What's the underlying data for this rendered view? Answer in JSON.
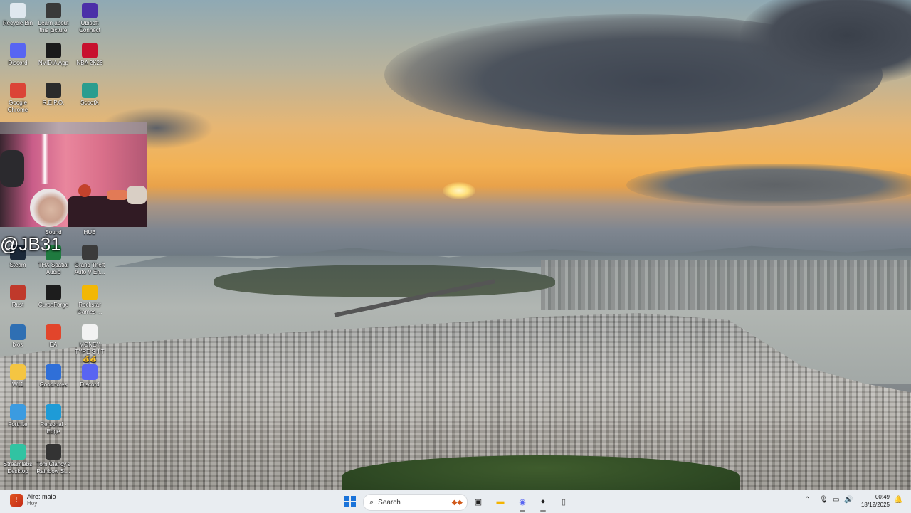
{
  "desktop": {
    "streamer_handle": "@JB31",
    "icons": [
      {
        "label": "Recycle Bin",
        "icon": "recycle-bin-icon",
        "color": "#dfe8ef"
      },
      {
        "label": "Learn about this picture",
        "icon": "camera-icon",
        "color": "#3a3a3a"
      },
      {
        "label": "Ubisoft Connect",
        "icon": "ubisoft-icon",
        "color": "#4b2fa8"
      },
      {
        "label": "Discord",
        "icon": "discord-icon",
        "color": "#5865f2"
      },
      {
        "label": "NVIDIA App",
        "icon": "nvidia-icon",
        "color": "#1b1b1b"
      },
      {
        "label": "NBA 2K26",
        "icon": "nba2k-icon",
        "color": "#c8102e"
      },
      {
        "label": "Google Chrome",
        "icon": "chrome-icon",
        "color": "#db4437"
      },
      {
        "label": "R.E.P.O.",
        "icon": "repo-icon",
        "color": "#2b2b2b"
      },
      {
        "label": "ScootX",
        "icon": "scootx-icon",
        "color": "#2a9d8f"
      },
      {
        "label": "Sound",
        "icon": "sound-icon",
        "color": "#555"
      },
      {
        "label": "HUB",
        "icon": "hub-icon",
        "color": "#555"
      },
      {
        "label": "Steam",
        "icon": "steam-icon",
        "color": "#1b2838"
      },
      {
        "label": "THX Spatial Audio",
        "icon": "thx-icon",
        "color": "#1f7a3f"
      },
      {
        "label": "Grand Theft Auto V En...",
        "icon": "gta-icon",
        "color": "#3b3b3b"
      },
      {
        "label": "Rust",
        "icon": "rust-icon",
        "color": "#c0392b"
      },
      {
        "label": "CurseForge",
        "icon": "curseforge-icon",
        "color": "#1d1d1d"
      },
      {
        "label": "Rockstar Games ...",
        "icon": "rockstar-icon",
        "color": "#f2b705"
      },
      {
        "label": "bios",
        "icon": "bios-icon",
        "color": "#2f6fb3"
      },
      {
        "label": "EA",
        "icon": "ea-icon",
        "color": "#e2452b"
      },
      {
        "label": "MONEY TYPE SH T💰💰",
        "icon": "text-file-icon",
        "color": "#f2f2f2"
      },
      {
        "label": "W11",
        "icon": "folder-icon",
        "color": "#f4c542"
      },
      {
        "label": "Goodnotes",
        "icon": "goodnotes-icon",
        "color": "#2f6fd8"
      },
      {
        "label": "Discord",
        "icon": "discord-icon",
        "color": "#5865f2"
      },
      {
        "label": "Fortnite",
        "icon": "fortnite-icon",
        "color": "#3b9be0"
      },
      {
        "label": "Personal - Edge",
        "icon": "edge-icon",
        "color": "#1e9bd7"
      },
      {
        "label": "Streamlabs Desktop",
        "icon": "streamlabs-icon",
        "color": "#31c3a2"
      },
      {
        "label": "Tom Clancy's Rainbow Si...",
        "icon": "rainbow-six-icon",
        "color": "#333"
      }
    ]
  },
  "taskbar": {
    "weather_main": "Aire: malo",
    "weather_sub": "Hoy",
    "search_placeholder": "Search",
    "time": "00:49",
    "date": "18/12/2025",
    "pinned": [
      {
        "name": "task-view-icon",
        "glyph": "▣",
        "color": "#222"
      },
      {
        "name": "file-explorer-icon",
        "glyph": "▬",
        "color": "#f4b400"
      },
      {
        "name": "discord-taskbar-icon",
        "glyph": "◉",
        "color": "#5865f2"
      },
      {
        "name": "obs-icon",
        "glyph": "●",
        "color": "#222"
      },
      {
        "name": "notepad-icon",
        "glyph": "▯",
        "color": "#555"
      }
    ]
  }
}
